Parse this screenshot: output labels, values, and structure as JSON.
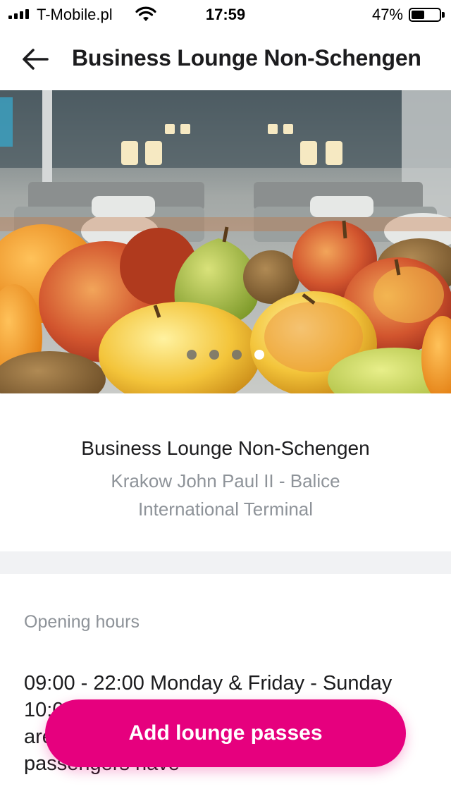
{
  "status_bar": {
    "carrier": "T-Mobile.pl",
    "time": "17:59",
    "battery_percent": "47%",
    "battery_level": 0.47,
    "icons": [
      "signal-icon",
      "wifi-icon",
      "battery-icon"
    ]
  },
  "nav": {
    "back_icon": "arrow-left-icon",
    "title": "Business Lounge Non-Schengen"
  },
  "carousel": {
    "slide_count": 4,
    "active_index": 3
  },
  "lounge": {
    "name": "Business Lounge Non-Schengen",
    "location": "Krakow John Paul II - Balice International Terminal"
  },
  "hours": {
    "label": "Opening hours",
    "text": "09:00 - 22:00 Monday & Friday - Sunday 10:00 - 22:00 Tuesday - Thursday Hours are subject to change. Non-Schengen passengers have"
  },
  "cta": {
    "label": "Add lounge passes",
    "color": "#e6007e"
  }
}
